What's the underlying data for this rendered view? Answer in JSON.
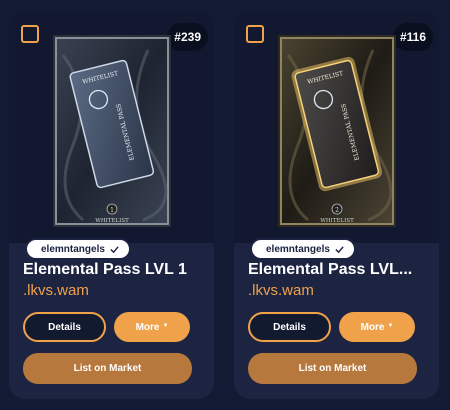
{
  "cards": [
    {
      "number": "#239",
      "collection": "elemntangels",
      "name": "Elemental Pass LVL 1",
      "owner": ".lkvs.wam",
      "art": {
        "label_top": "WHITELIST",
        "label_bottom": "WHITELIST",
        "title": "ELEMENTAL PASS",
        "level": "1",
        "glow": "#c9d6e8"
      }
    },
    {
      "number": "#116",
      "collection": "elemntangels",
      "name": "Elemental Pass LVL...",
      "owner": ".lkvs.wam",
      "art": {
        "label_top": "WHITELIST",
        "label_bottom": "WHITELIST",
        "title": "ELEMENTAL PASS",
        "level": "2",
        "glow": "#f2c766"
      }
    }
  ],
  "buttons": {
    "details": "Details",
    "more": "More",
    "list_on_market": "List on Market"
  },
  "colors": {
    "accent": "#f0a24a",
    "market_button": "#b7783d",
    "card_bg": "#1c2442",
    "page_bg": "#131a33"
  }
}
